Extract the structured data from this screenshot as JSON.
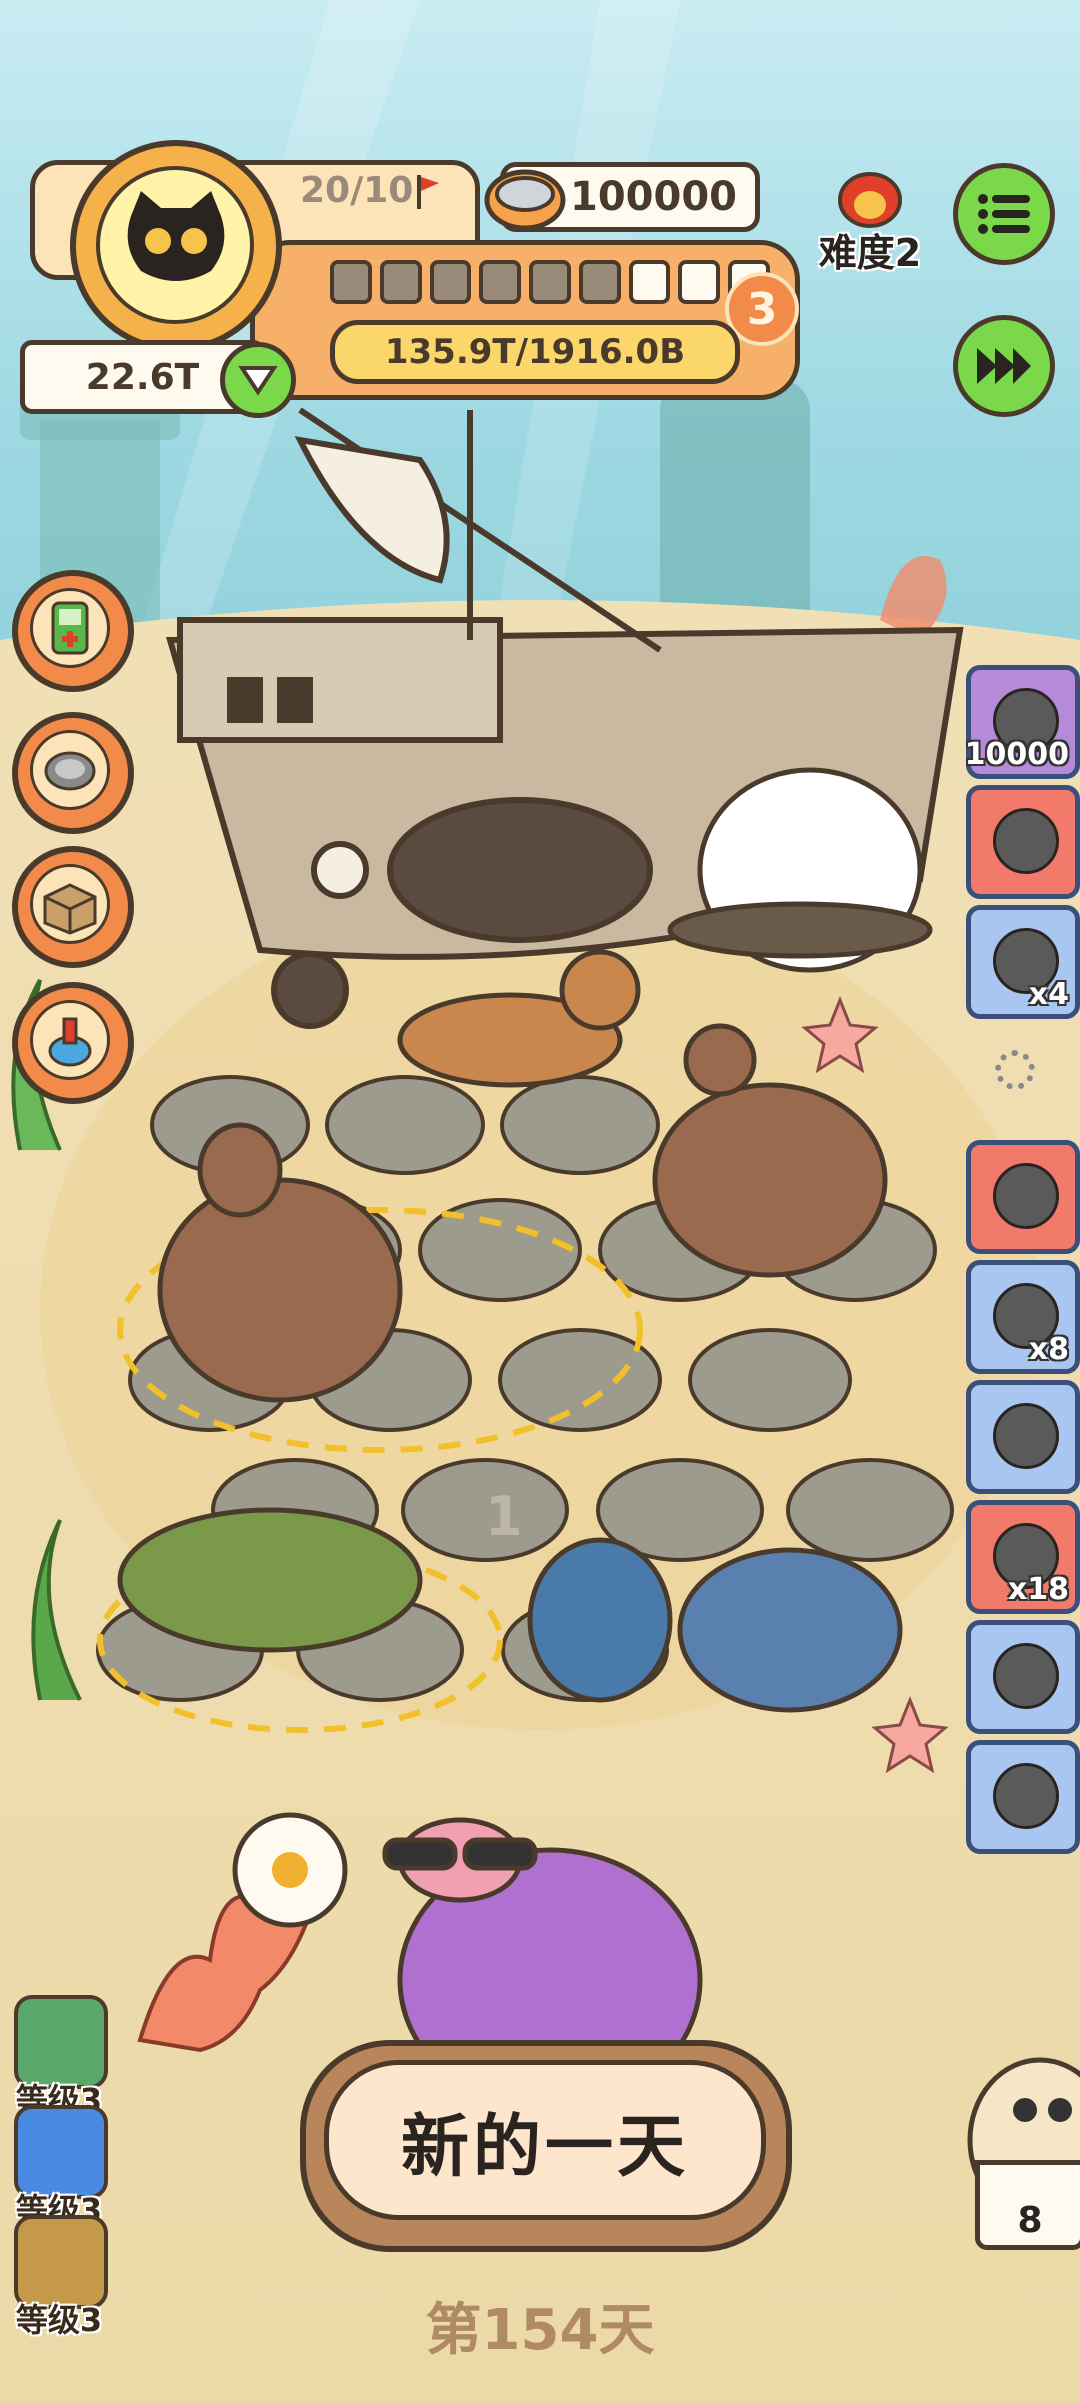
{
  "hud": {
    "capacity": "20/10",
    "coins": "100000",
    "player_value": "22.6T",
    "progress_text": "135.9T/1916.0B",
    "level_badge": "3",
    "difficulty": "难度2",
    "progress_segments_filled": 6,
    "progress_segments_total": 9
  },
  "side_items": [
    {
      "icon": "meat-ball-icon",
      "count": "10000",
      "bg": "#b58ad8"
    },
    {
      "icon": "green-bomb-icon",
      "count": "",
      "bg": "#f27a6a"
    },
    {
      "icon": "tin-can-icon",
      "count": "x4",
      "bg": "#a9c6f0"
    },
    {
      "icon": "bones-icon",
      "count": "",
      "bg": "#f27a6a"
    },
    {
      "icon": "donut-icon",
      "count": "x8",
      "bg": "#a9c6f0"
    },
    {
      "icon": "camera-icon",
      "count": "",
      "bg": "#a9c6f0"
    },
    {
      "icon": "kettle-icon",
      "count": "x18",
      "bg": "#f27a6a"
    },
    {
      "icon": "jar-icon",
      "count": "",
      "bg": "#a9c6f0"
    },
    {
      "icon": "seed-bag-icon",
      "count": "",
      "bg": "#a9c6f0"
    }
  ],
  "levels": [
    {
      "label": "等级3",
      "color": "#5aa86a"
    },
    {
      "label": "等级3",
      "color": "#4a8ae0"
    },
    {
      "label": "等级3",
      "color": "#c49a4a"
    }
  ],
  "main_button": "新的一天",
  "day_label": "第154天",
  "slot_number": "1",
  "companion_count": "8"
}
